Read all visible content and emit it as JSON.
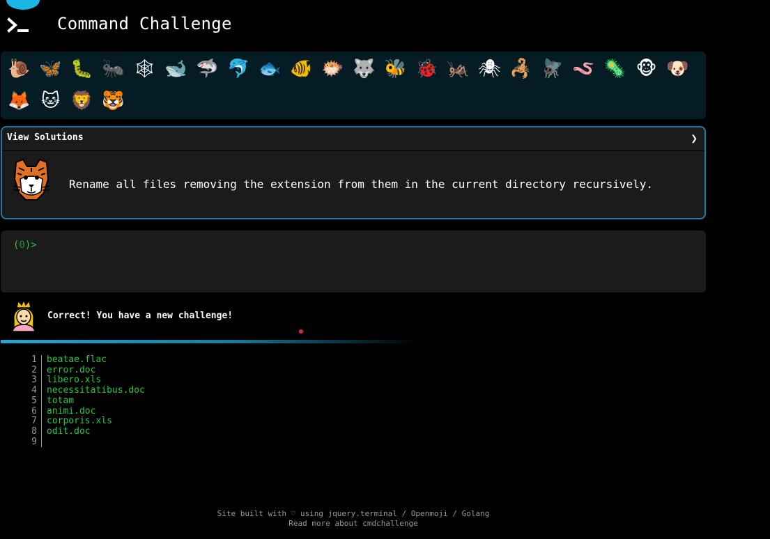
{
  "header": {
    "title": "Command Challenge"
  },
  "badges": {
    "row1": [
      {
        "icon": "snail-icon",
        "glyph": "🐌"
      },
      {
        "icon": "butterfly-icon",
        "glyph": "🦋"
      },
      {
        "icon": "bug-icon",
        "glyph": "🐛"
      },
      {
        "icon": "ant-icon",
        "glyph": "🐜"
      },
      {
        "icon": "spider-web-icon",
        "glyph": "🕸"
      },
      {
        "icon": "whale-icon",
        "glyph": "🐋"
      },
      {
        "icon": "shark-icon",
        "glyph": "🦈"
      },
      {
        "icon": "dolphin-icon",
        "glyph": "🐬"
      },
      {
        "icon": "fish-icon",
        "glyph": "🐟"
      },
      {
        "icon": "tropical-fish-icon",
        "glyph": "🐠"
      },
      {
        "icon": "blowfish-icon",
        "glyph": "🐡"
      },
      {
        "icon": "wolf-icon",
        "glyph": "🐺"
      },
      {
        "icon": "bee-icon",
        "glyph": "🐝"
      },
      {
        "icon": "ladybug-icon",
        "glyph": "🐞"
      },
      {
        "icon": "cricket-icon",
        "glyph": "🦗"
      },
      {
        "icon": "spider-icon",
        "glyph": "🕷"
      },
      {
        "icon": "scorpion-icon",
        "glyph": "🦂"
      },
      {
        "icon": "fly-icon",
        "glyph": "🪰"
      },
      {
        "icon": "worm-icon",
        "glyph": "🪱"
      },
      {
        "icon": "microbe-icon",
        "glyph": "🦠"
      },
      {
        "icon": "monkey-face-icon",
        "glyph": "🐵"
      },
      {
        "icon": "dog-face-icon",
        "glyph": "🐶"
      }
    ],
    "row2": [
      {
        "icon": "fox-icon",
        "glyph": "🦊"
      },
      {
        "icon": "cat-face-icon",
        "glyph": "🐱"
      },
      {
        "icon": "lion-icon",
        "glyph": "🦁"
      },
      {
        "icon": "tiger-face-icon",
        "glyph": "🐯"
      }
    ]
  },
  "challenge": {
    "view_solutions": "View Solutions",
    "chevron": "❯",
    "description": "Rename all files removing the extension from them in the current directory recursively."
  },
  "terminal": {
    "prompt_open": "(",
    "prompt_code": "0",
    "prompt_close": ")>"
  },
  "status": {
    "message": "Correct! You have a new challenge!"
  },
  "progress": {
    "fraction": 0.54
  },
  "files": [
    {
      "line": "1",
      "name": "beatae.flac"
    },
    {
      "line": "2",
      "name": "error.doc"
    },
    {
      "line": "3",
      "name": "libero.xls"
    },
    {
      "line": "4",
      "name": "necessitatibus.doc"
    },
    {
      "line": "5",
      "name": "totam"
    },
    {
      "line": "6",
      "name": "animi.doc"
    },
    {
      "line": "7",
      "name": "corporis.xls"
    },
    {
      "line": "8",
      "name": "odit.doc"
    },
    {
      "line": "9",
      "name": ""
    }
  ],
  "footer": {
    "line1": "Site built with ♡ using jquery.terminal / Openmoji / Golang",
    "line2": "Read more about cmdchallenge"
  }
}
